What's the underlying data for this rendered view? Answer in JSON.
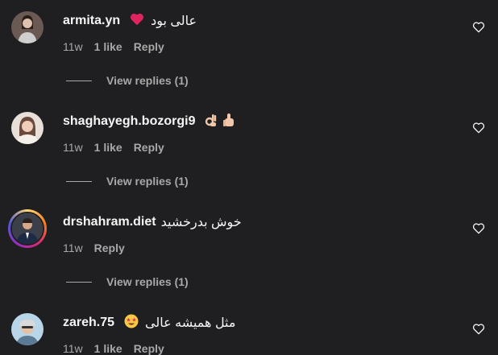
{
  "comments": [
    {
      "username": "armita.yn",
      "text": "عالی بود",
      "time": "11w",
      "likes": "1 like",
      "reply": "Reply",
      "replies": "View replies (1)"
    },
    {
      "username": "shaghayegh.bozorgi9",
      "text": "",
      "time": "11w",
      "likes": "1 like",
      "reply": "Reply",
      "replies": "View replies (1)"
    },
    {
      "username": "drshahram.diet",
      "text": "خوش بدرخشید",
      "time": "11w",
      "likes": "",
      "reply": "Reply",
      "replies": "View replies (1)"
    },
    {
      "username": "zareh.75",
      "text": "مثل همیشه عالی",
      "time": "11w",
      "likes": "1 like",
      "reply": "Reply",
      "replies": ""
    }
  ],
  "icons": {
    "heart": "heart-outline-icon"
  },
  "colors": {
    "background": "#1f1f22",
    "text_primary": "#f5f5f5",
    "text_secondary": "#a8a8a8",
    "emoji_heart": "#e0245e"
  }
}
